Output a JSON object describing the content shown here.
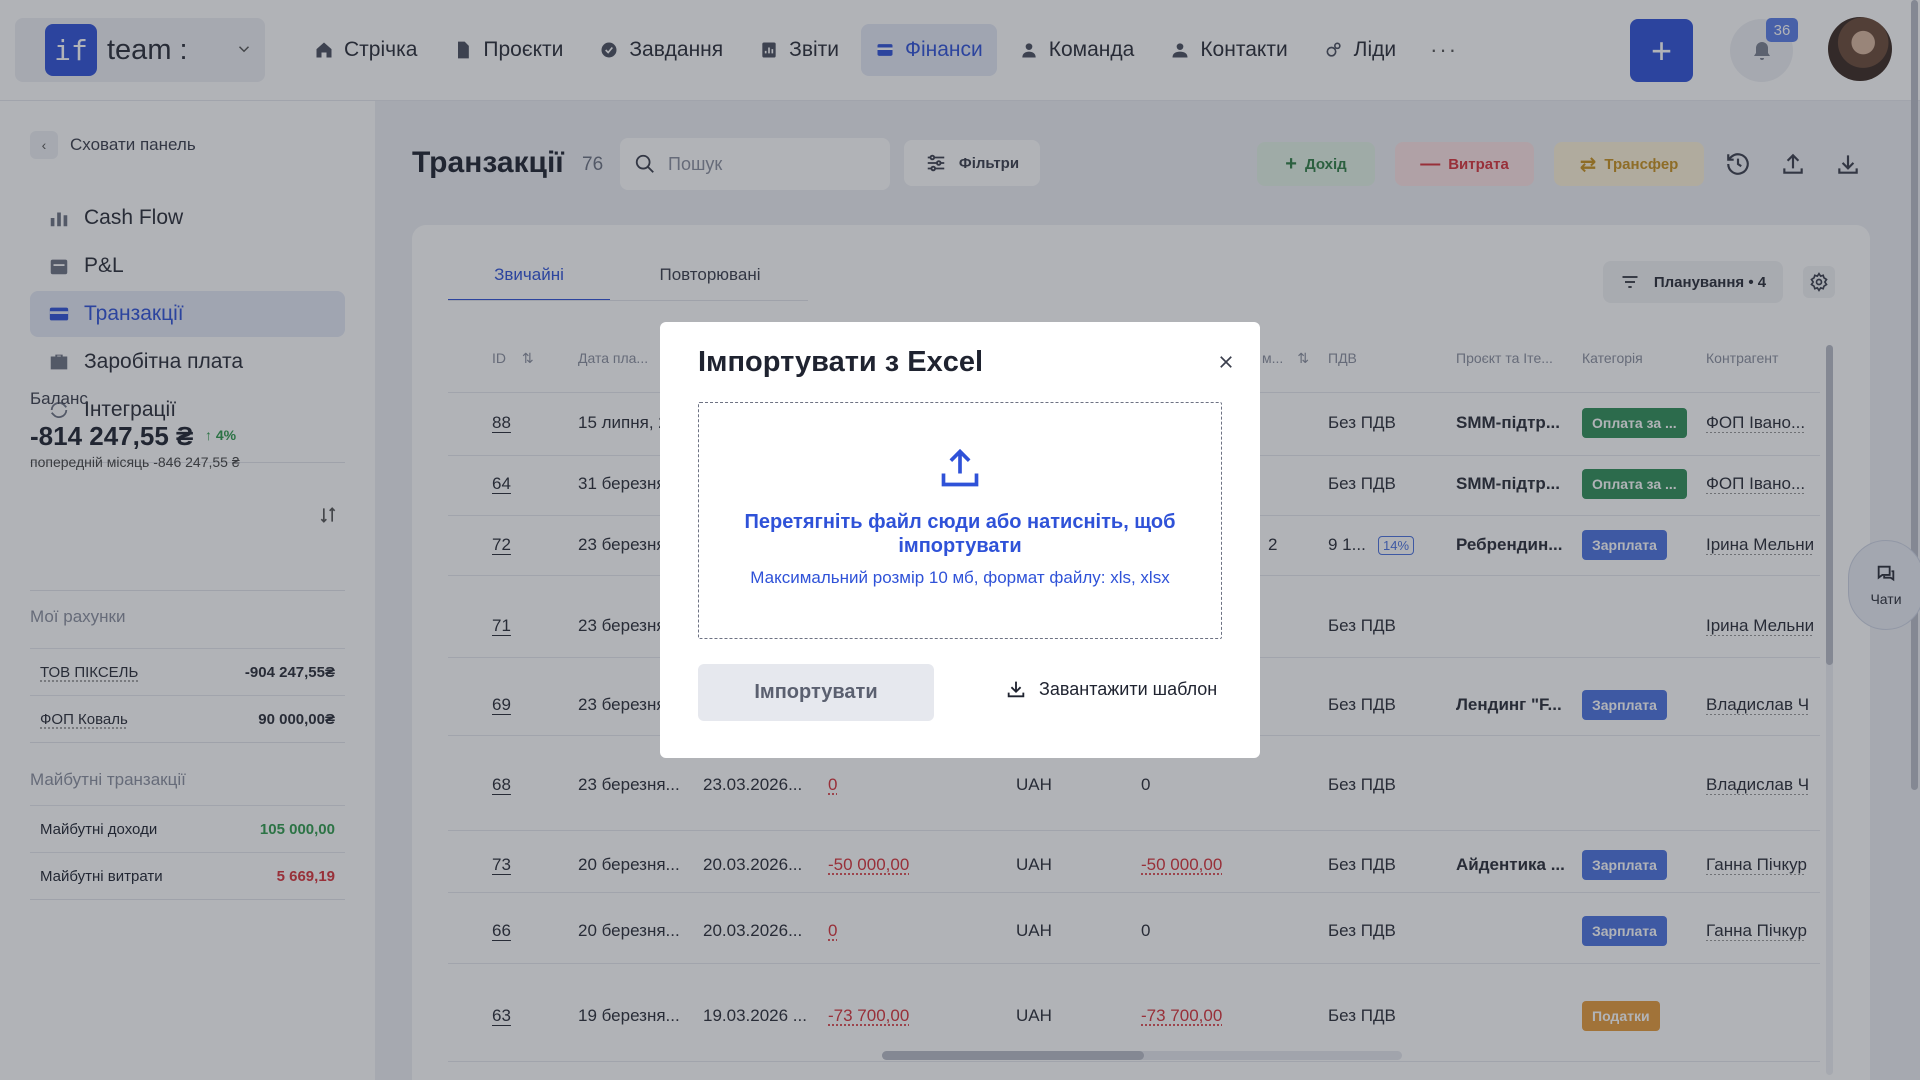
{
  "workspace": {
    "logo": "if",
    "name": "team :"
  },
  "nav": [
    {
      "label": "Стрічка",
      "icon": "home-icon"
    },
    {
      "label": "Проєкти",
      "icon": "document-icon"
    },
    {
      "label": "Завдання",
      "icon": "check-circle-icon"
    },
    {
      "label": "Звіти",
      "icon": "report-icon"
    },
    {
      "label": "Фінанси",
      "icon": "wallet-icon",
      "active": true
    },
    {
      "label": "Команда",
      "icon": "person-icon"
    },
    {
      "label": "Контакти",
      "icon": "contacts-icon"
    },
    {
      "label": "Ліди",
      "icon": "leads-icon"
    }
  ],
  "nav_more": "···",
  "header": {
    "plus": "+",
    "notifications_count": "36"
  },
  "sidebar": {
    "hide_label": "Сховати панель",
    "items": [
      {
        "label": "Cash Flow",
        "icon": "bar-chart-icon"
      },
      {
        "label": "P&L",
        "icon": "calendar-icon"
      },
      {
        "label": "Транзакції",
        "icon": "card-icon",
        "active": true
      },
      {
        "label": "Заробітна плата",
        "icon": "briefcase-icon"
      },
      {
        "label": "Інтеграції",
        "icon": "sync-icon"
      }
    ],
    "balance_label": "Баланс",
    "balance_value": "-814 247,55 ₴",
    "balance_trend": "4%",
    "balance_prev": "попередній місяць -846 247,55 ₴",
    "accounts_title": "Мої рахунки",
    "accounts": [
      {
        "name": "ТОВ ПІКСЕЛЬ",
        "value": "-904 247,55₴"
      },
      {
        "name": "ФОП Коваль",
        "value": "90 000,00₴"
      }
    ],
    "future_title": "Майбутні транзакції",
    "future": [
      {
        "name": "Майбутні доходи",
        "value": "105 000,00",
        "tone": "green"
      },
      {
        "name": "Майбутні витрати",
        "value": "5 669,19",
        "tone": "red"
      }
    ]
  },
  "main": {
    "title": "Транзакції",
    "count": "76",
    "search_placeholder": "Пошук",
    "filters_label": "Фільтри",
    "income_label": "Дохід",
    "expense_label": "Витрата",
    "transfer_label": "Трансфер",
    "colors": {
      "income_bg": "#e3f3e6",
      "income_fg": "#2f7d45",
      "expense_bg": "#fde3e5",
      "expense_fg": "#d8323a",
      "transfer_bg": "#fdf2d8",
      "transfer_fg": "#c9921e",
      "accent": "#2f52d8"
    },
    "tabs": [
      "Звичайні",
      "Повторювані"
    ],
    "planning_label": "Планування • 4",
    "columns": [
      "ID",
      "Дата пла...",
      "м...",
      "ПДВ",
      "Проєкт та Іте...",
      "Категорія",
      "Контрагент"
    ],
    "rows": [
      {
        "id": "88",
        "date1": "15 липня, 2...",
        "date2": "",
        "amount": "",
        "currency": "",
        "amount2": "",
        "pdv": "Без ПДВ",
        "project": "SMM-підтр...",
        "category": "Оплата за ...",
        "cat_color": "green",
        "contractor": "ФОП Івано..."
      },
      {
        "id": "64",
        "date1": "31 березня...",
        "date2": "",
        "amount": "",
        "currency": "",
        "amount2": "",
        "pdv": "Без ПДВ",
        "project": "SMM-підтр...",
        "category": "Оплата за ...",
        "cat_color": "green",
        "contractor": "ФОП Івано..."
      },
      {
        "id": "72",
        "date1": "23 березня...",
        "date2": "",
        "amount": "",
        "currency": "",
        "amount2": "2",
        "pdv": "9 1...",
        "pct": "14%",
        "project": "Ребрендин...",
        "category": "Зарплата",
        "cat_color": "blue",
        "contractor": "Ірина Мельни"
      },
      {
        "id": "71",
        "date1": "23 березня...",
        "date2": "",
        "amount": "",
        "currency": "",
        "amount2": "",
        "pdv": "Без ПДВ",
        "project": "",
        "category": "",
        "cat_color": "",
        "contractor": "Ірина Мельни"
      },
      {
        "id": "69",
        "date1": "23 березня...",
        "date2": "",
        "amount": "",
        "currency": "",
        "amount2": "",
        "pdv": "Без ПДВ",
        "project": "Лендинг \"F...",
        "category": "Зарплата",
        "cat_color": "blue",
        "contractor": "Владислав Ч"
      },
      {
        "id": "68",
        "date1": "23 березня...",
        "date2": "23.03.2026...",
        "amount": "0",
        "currency": "UAH",
        "amount2": "0",
        "pdv": "Без ПДВ",
        "project": "",
        "category": "",
        "cat_color": "",
        "contractor": "Владислав Ч"
      },
      {
        "id": "73",
        "date1": "20 березня...",
        "date2": "20.03.2026...",
        "amount": "-50 000,00",
        "currency": "UAH",
        "amount2": "-50 000,00",
        "pdv": "Без ПДВ",
        "project": "Айдентика ...",
        "category": "Зарплата",
        "cat_color": "blue",
        "contractor": "Ганна Пічкур"
      },
      {
        "id": "66",
        "date1": "20 березня...",
        "date2": "20.03.2026...",
        "amount": "0",
        "currency": "UAH",
        "amount2": "0",
        "pdv": "Без ПДВ",
        "project": "",
        "category": "Зарплата",
        "cat_color": "blue",
        "contractor": "Ганна Пічкур"
      },
      {
        "id": "63",
        "date1": "19 березня...",
        "date2": "19.03.2026 ...",
        "amount": "-73 700,00",
        "currency": "UAH",
        "amount2": "-73 700,00",
        "pdv": "Без ПДВ",
        "project": "",
        "category": "Податки",
        "cat_color": "orange",
        "contractor": ""
      }
    ]
  },
  "chat_fab_label": "Чати",
  "modal": {
    "title": "Імпортувати з Excel",
    "drop_text": "Перетягніть файл сюди або натисніть, щоб імпортувати",
    "hint": "Максимальний розмір 10 мб, формат файлу: xls, xlsx",
    "import_label": "Імпортувати",
    "template_label": "Завантажити шаблон"
  }
}
